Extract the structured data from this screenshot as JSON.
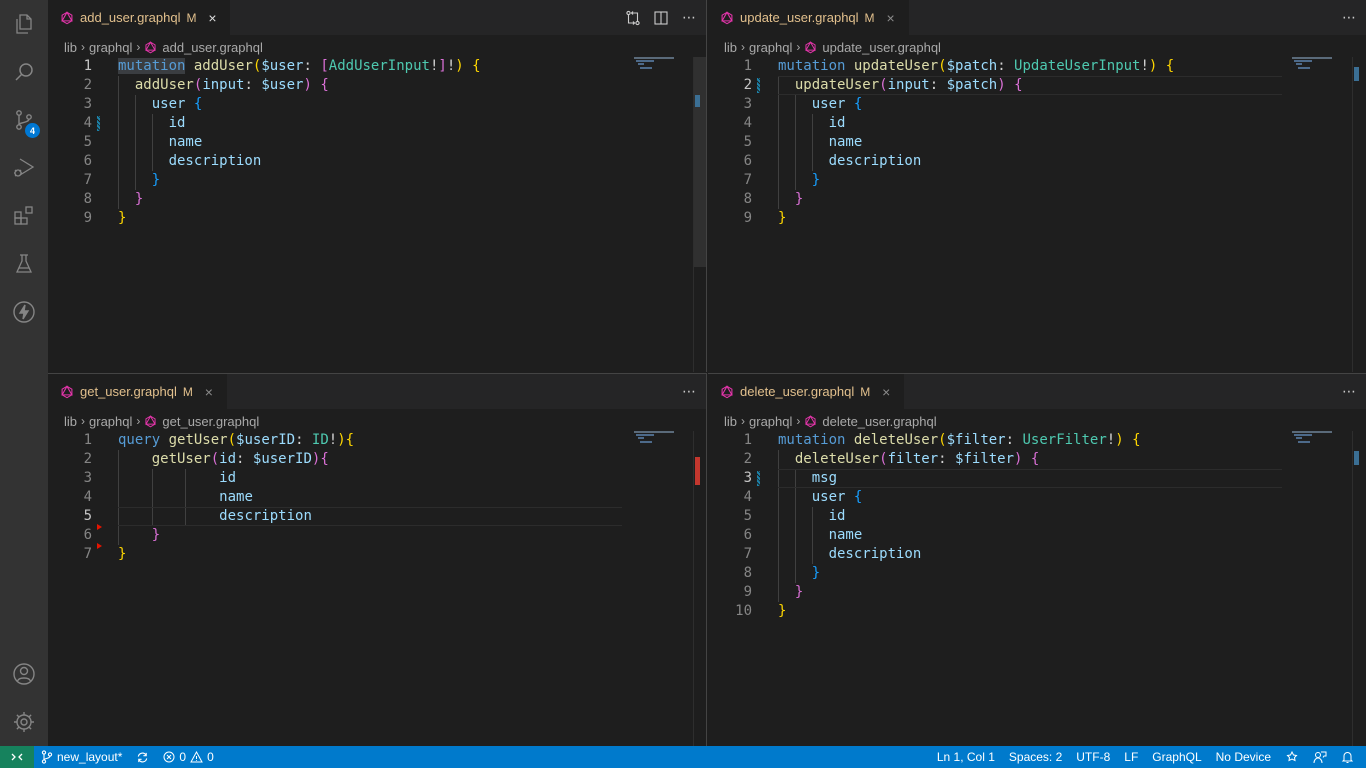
{
  "activity_bar": {
    "items": [
      {
        "name": "explorer",
        "icon": "files-icon"
      },
      {
        "name": "search",
        "icon": "search-icon"
      },
      {
        "name": "source-control",
        "icon": "source-control-icon",
        "badge": "4"
      },
      {
        "name": "run-debug",
        "icon": "run-debug-icon"
      },
      {
        "name": "extensions",
        "icon": "extensions-icon"
      },
      {
        "name": "testing",
        "icon": "beaker-icon"
      },
      {
        "name": "lightning",
        "icon": "lightning-icon"
      }
    ],
    "bottom": [
      {
        "name": "accounts",
        "icon": "account-icon"
      },
      {
        "name": "manage",
        "icon": "gear-icon"
      }
    ]
  },
  "panes": [
    {
      "id": "tl",
      "tab": {
        "label": "add_user.graphql",
        "status": "M",
        "close": "×",
        "active": true
      },
      "actions": [
        "⋯"
      ],
      "breadcrumb": [
        "lib",
        "graphql",
        "add_user.graphql"
      ],
      "current_line": 1,
      "lines": [
        [
          [
            "kw sel-word",
            "mutation"
          ],
          [
            "pl",
            " "
          ],
          [
            "fn",
            "addUser"
          ],
          [
            "p1",
            "("
          ],
          [
            "var",
            "$user"
          ],
          [
            "pl",
            ": "
          ],
          [
            "p2",
            "["
          ],
          [
            "ty",
            "AddUserInput"
          ],
          [
            "pl",
            "!"
          ],
          [
            "p2",
            "]"
          ],
          [
            "pl",
            "!"
          ],
          [
            "p1",
            ")"
          ],
          [
            "pl",
            " "
          ],
          [
            "p1",
            "{"
          ]
        ],
        [
          [
            "pl",
            "  "
          ],
          [
            "fn",
            "addUser"
          ],
          [
            "p2",
            "("
          ],
          [
            "var",
            "input"
          ],
          [
            "pl",
            ": "
          ],
          [
            "var",
            "$user"
          ],
          [
            "p2",
            ")"
          ],
          [
            "pl",
            " "
          ],
          [
            "p2",
            "{"
          ]
        ],
        [
          [
            "pl",
            "    "
          ],
          [
            "var",
            "user"
          ],
          [
            "pl",
            " "
          ],
          [
            "p3",
            "{"
          ]
        ],
        [
          [
            "pl",
            "      "
          ],
          [
            "var",
            "id"
          ]
        ],
        [
          [
            "pl",
            "      "
          ],
          [
            "var",
            "name"
          ]
        ],
        [
          [
            "pl",
            "      "
          ],
          [
            "var",
            "description"
          ]
        ],
        [
          [
            "pl",
            "    "
          ],
          [
            "p3",
            "}"
          ]
        ],
        [
          [
            "pl",
            "  "
          ],
          [
            "p2",
            "}"
          ]
        ],
        [
          [
            "p1",
            "}"
          ]
        ]
      ]
    },
    {
      "id": "tr",
      "tab": {
        "label": "update_user.graphql",
        "status": "M",
        "close": "×",
        "active": false
      },
      "actions": [
        "⋯"
      ],
      "breadcrumb": [
        "lib",
        "graphql",
        "update_user.graphql"
      ],
      "current_line": 2,
      "lines": [
        [
          [
            "kw",
            "mutation"
          ],
          [
            "pl",
            " "
          ],
          [
            "fn",
            "updateUser"
          ],
          [
            "p1",
            "("
          ],
          [
            "var",
            "$patch"
          ],
          [
            "pl",
            ": "
          ],
          [
            "ty",
            "UpdateUserInput"
          ],
          [
            "pl",
            "!"
          ],
          [
            "p1",
            ")"
          ],
          [
            "pl",
            " "
          ],
          [
            "p1",
            "{"
          ]
        ],
        [
          [
            "pl",
            "  "
          ],
          [
            "fn",
            "updateUser"
          ],
          [
            "p2",
            "("
          ],
          [
            "var",
            "input"
          ],
          [
            "pl",
            ": "
          ],
          [
            "var",
            "$patch"
          ],
          [
            "p2",
            ")"
          ],
          [
            "pl",
            " "
          ],
          [
            "p2",
            "{"
          ]
        ],
        [
          [
            "pl",
            "    "
          ],
          [
            "var",
            "user"
          ],
          [
            "pl",
            " "
          ],
          [
            "p3",
            "{"
          ]
        ],
        [
          [
            "pl",
            "      "
          ],
          [
            "var",
            "id"
          ]
        ],
        [
          [
            "pl",
            "      "
          ],
          [
            "var",
            "name"
          ]
        ],
        [
          [
            "pl",
            "      "
          ],
          [
            "var",
            "description"
          ]
        ],
        [
          [
            "pl",
            "    "
          ],
          [
            "p3",
            "}"
          ]
        ],
        [
          [
            "pl",
            "  "
          ],
          [
            "p2",
            "}"
          ]
        ],
        [
          [
            "p1",
            "}"
          ]
        ]
      ]
    },
    {
      "id": "bl",
      "tab": {
        "label": "get_user.graphql",
        "status": "M",
        "close": "×",
        "active": false
      },
      "actions": [
        "⋯"
      ],
      "breadcrumb": [
        "lib",
        "graphql",
        "get_user.graphql"
      ],
      "current_line": 5,
      "lines": [
        [
          [
            "kw",
            "query"
          ],
          [
            "pl",
            " "
          ],
          [
            "fn",
            "getUser"
          ],
          [
            "p1",
            "("
          ],
          [
            "var",
            "$userID"
          ],
          [
            "pl",
            ": "
          ],
          [
            "ty",
            "ID"
          ],
          [
            "pl",
            "!"
          ],
          [
            "p1",
            ")"
          ],
          [
            "p1",
            "{"
          ]
        ],
        [
          [
            "pl",
            "    "
          ],
          [
            "fn",
            "getUser"
          ],
          [
            "p2",
            "("
          ],
          [
            "var",
            "id"
          ],
          [
            "pl",
            ": "
          ],
          [
            "var",
            "$userID"
          ],
          [
            "p2",
            ")"
          ],
          [
            "p2",
            "{"
          ]
        ],
        [
          [
            "pl",
            "            "
          ],
          [
            "var",
            "id"
          ]
        ],
        [
          [
            "pl",
            "            "
          ],
          [
            "var",
            "name"
          ]
        ],
        [
          [
            "pl",
            "            "
          ],
          [
            "var",
            "description"
          ]
        ],
        [
          [
            "pl",
            "    "
          ],
          [
            "p2",
            "}"
          ]
        ],
        [
          [
            "p1",
            "}"
          ]
        ]
      ]
    },
    {
      "id": "br",
      "tab": {
        "label": "delete_user.graphql",
        "status": "M",
        "close": "×",
        "active": false
      },
      "actions": [
        "⋯"
      ],
      "breadcrumb": [
        "lib",
        "graphql",
        "delete_user.graphql"
      ],
      "current_line": 3,
      "lines": [
        [
          [
            "kw",
            "mutation"
          ],
          [
            "pl",
            " "
          ],
          [
            "fn",
            "deleteUser"
          ],
          [
            "p1",
            "("
          ],
          [
            "var",
            "$filter"
          ],
          [
            "pl",
            ": "
          ],
          [
            "ty",
            "UserFilter"
          ],
          [
            "pl",
            "!"
          ],
          [
            "p1",
            ")"
          ],
          [
            "pl",
            " "
          ],
          [
            "p1",
            "{"
          ]
        ],
        [
          [
            "pl",
            "  "
          ],
          [
            "fn",
            "deleteUser"
          ],
          [
            "p2",
            "("
          ],
          [
            "var",
            "filter"
          ],
          [
            "pl",
            ": "
          ],
          [
            "var",
            "$filter"
          ],
          [
            "p2",
            ")"
          ],
          [
            "pl",
            " "
          ],
          [
            "p2",
            "{"
          ]
        ],
        [
          [
            "pl",
            "    "
          ],
          [
            "var",
            "msg"
          ]
        ],
        [
          [
            "pl",
            "    "
          ],
          [
            "var",
            "user"
          ],
          [
            "pl",
            " "
          ],
          [
            "p3",
            "{"
          ]
        ],
        [
          [
            "pl",
            "      "
          ],
          [
            "var",
            "id"
          ]
        ],
        [
          [
            "pl",
            "      "
          ],
          [
            "var",
            "name"
          ]
        ],
        [
          [
            "pl",
            "      "
          ],
          [
            "var",
            "description"
          ]
        ],
        [
          [
            "pl",
            "    "
          ],
          [
            "p3",
            "}"
          ]
        ],
        [
          [
            "pl",
            "  "
          ],
          [
            "p2",
            "}"
          ]
        ],
        [
          [
            "p1",
            "}"
          ]
        ]
      ]
    }
  ],
  "status_bar": {
    "branch": "new_layout*",
    "errors": "0",
    "warnings": "0",
    "position": "Ln 1, Col 1",
    "indent": "Spaces: 2",
    "encoding": "UTF-8",
    "eol": "LF",
    "language": "GraphQL",
    "device": "No Device"
  },
  "colors": {
    "status_bar": "#007acc",
    "remote": "#16825d",
    "badge": "#0078d4",
    "modified": "#e2c08d",
    "error": "#e51400"
  }
}
